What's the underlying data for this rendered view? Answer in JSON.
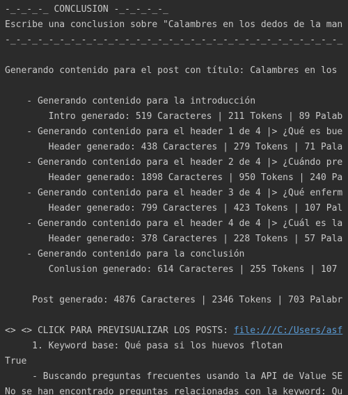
{
  "console": {
    "colors": {
      "background": "#2b2b2b",
      "text": "#c8c8c8",
      "link": "#5a9bd5"
    },
    "lines": [
      "-_-_-_-_ CONCLUSION -_-_-_-_-_",
      "Escribe una conclusion sobre \"Calambres en los dedos de la man",
      "-_-_-_-_-_-_-_-_-_-_-_-_-_-_-_-_-_-_-_-_-_-_-_-_-_-_-_-_-_-_-_",
      "",
      "Generando contenido para el post con título: Calambres en los",
      "",
      "    - Generando contenido para la introducción",
      "        Intro generado: 519 Caracteres | 211 Tokens | 89 Palab",
      "    - Generando contenido para el header 1 de 4 |> ¿Qué es bue",
      "        Header generado: 438 Caracteres | 279 Tokens | 71 Pala",
      "    - Generando contenido para el header 2 de 4 |> ¿Cuándo pre",
      "        Header generado: 1898 Caracteres | 950 Tokens | 240 Pa",
      "    - Generando contenido para el header 3 de 4 |> ¿Qué enferm",
      "        Header generado: 799 Caracteres | 423 Tokens | 107 Pal",
      "    - Generando contenido para el header 4 de 4 |> ¿Cuál es la",
      "        Header generado: 378 Caracteres | 228 Tokens | 57 Pala",
      "    - Generando contenido para la conclusión",
      "        Conlusion generado: 614 Caracteres | 255 Tokens | 107",
      "",
      "     Post generado: 4876 Caracteres | 2346 Tokens | 703 Palabr",
      "",
      "<> <> CLICK PARA PREVISUALIZAR LOS POSTS: ",
      "     1. Keyword base: Qué pasa si los huevos flotan",
      "True",
      "     - Buscando preguntas frecuentes usando la API de Value SE",
      "No se han encontrado preguntas relacionadas con la keyword: Qu"
    ],
    "link_text": "file:///C:/Users/asf"
  }
}
